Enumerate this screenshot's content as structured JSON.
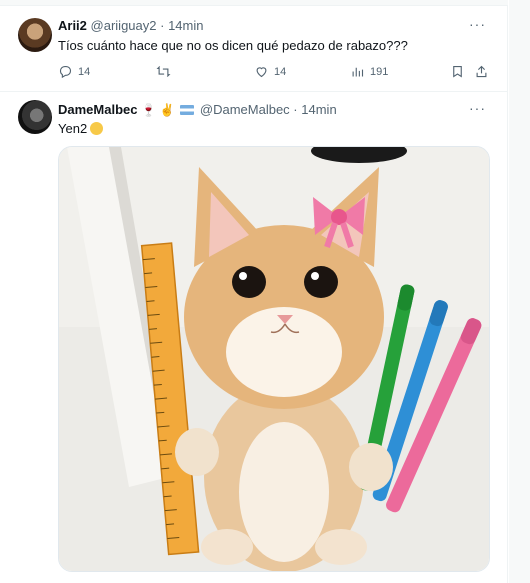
{
  "tweets": [
    {
      "display_name": "Arii2",
      "handle": "@ariiguay2",
      "time": "14min",
      "text": "Tíos cuánto hace que no os dicen qué pedazo de rabazo???",
      "replies": "14",
      "retweets": "",
      "likes": "14",
      "views": "191"
    },
    {
      "display_name": "DameMalbec",
      "handle": "@DameMalbec",
      "time": "14min",
      "text": "Yen2"
    }
  ],
  "separator": "·",
  "more_label": "···",
  "colors": {
    "text": "#0f1419",
    "muted": "#536471",
    "border": "#eff3f4"
  }
}
